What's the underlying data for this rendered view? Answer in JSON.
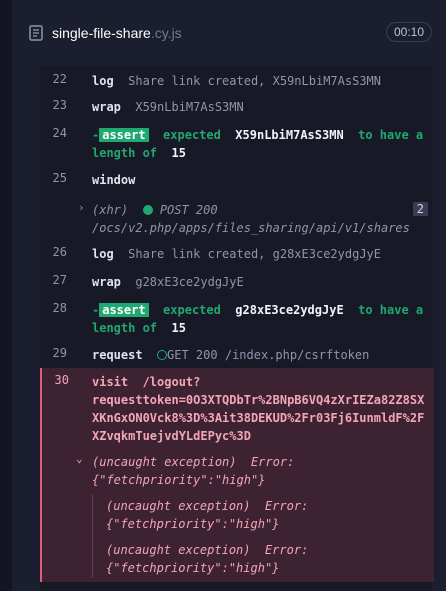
{
  "header": {
    "spec_base": "single-file-share",
    "spec_ext": ".cy.js",
    "duration": "00:10"
  },
  "rows": {
    "r22": {
      "num": "22",
      "cmd": "log",
      "msg": "Share link created, X59nLbiM7AsS3MN"
    },
    "r23": {
      "num": "23",
      "cmd": "wrap",
      "msg": "X59nLbiM7AsS3MN"
    },
    "r24": {
      "num": "24",
      "dash": "-",
      "badge": "assert",
      "expected": "expected",
      "value": "X59nLbiM7AsS3MN",
      "to_have": "to have a",
      "length_of": "length of",
      "length": "15"
    },
    "r25": {
      "num": "25",
      "cmd": "window"
    },
    "xhr": {
      "label": "(xhr)",
      "method_status": "POST 200",
      "url": "/ocs/v2.php/apps/files_sharing/api/v1/shares",
      "count": "2"
    },
    "r26": {
      "num": "26",
      "cmd": "log",
      "msg": "Share link created, g28xE3ce2ydgJyE"
    },
    "r27": {
      "num": "27",
      "cmd": "wrap",
      "msg": "g28xE3ce2ydgJyE"
    },
    "r28": {
      "num": "28",
      "dash": "-",
      "badge": "assert",
      "expected": "expected",
      "value": "g28xE3ce2ydgJyE",
      "to_have": "to have a",
      "length_of": "length of",
      "length": "15"
    },
    "r29": {
      "num": "29",
      "cmd": "request",
      "method_status": "GET 200",
      "url": "/index.php/csrftoken"
    },
    "r30": {
      "num": "30",
      "cmd": "visit",
      "line1": "/logout?",
      "line2": "requesttoken=0O3XTQDbTr%2BNpB6VQ4zXrIEZa82Z8SX",
      "line3": "XKnGxON0Vck8%3D%3Ait38DEKUD%2Fr03Fj6IunmldF%2F",
      "line4": "XZvqkmTuejvdYLdEPyc%3D"
    }
  },
  "errors": {
    "main": {
      "label": "(uncaught exception)",
      "error": "Error:",
      "detail": "{\"fetchpriority\":\"high\"}"
    },
    "sub1": {
      "label": "(uncaught exception)",
      "error": "Error:",
      "detail": "{\"fetchpriority\":\"high\"}"
    },
    "sub2": {
      "label": "(uncaught exception)",
      "error": "Error:",
      "detail": "{\"fetchpriority\":\"high\"}"
    }
  },
  "colors": {
    "background": "#1b1e2e",
    "assert_green": "#1fa971",
    "error_bg": "#3d2232",
    "error_border": "#e05c7a"
  }
}
